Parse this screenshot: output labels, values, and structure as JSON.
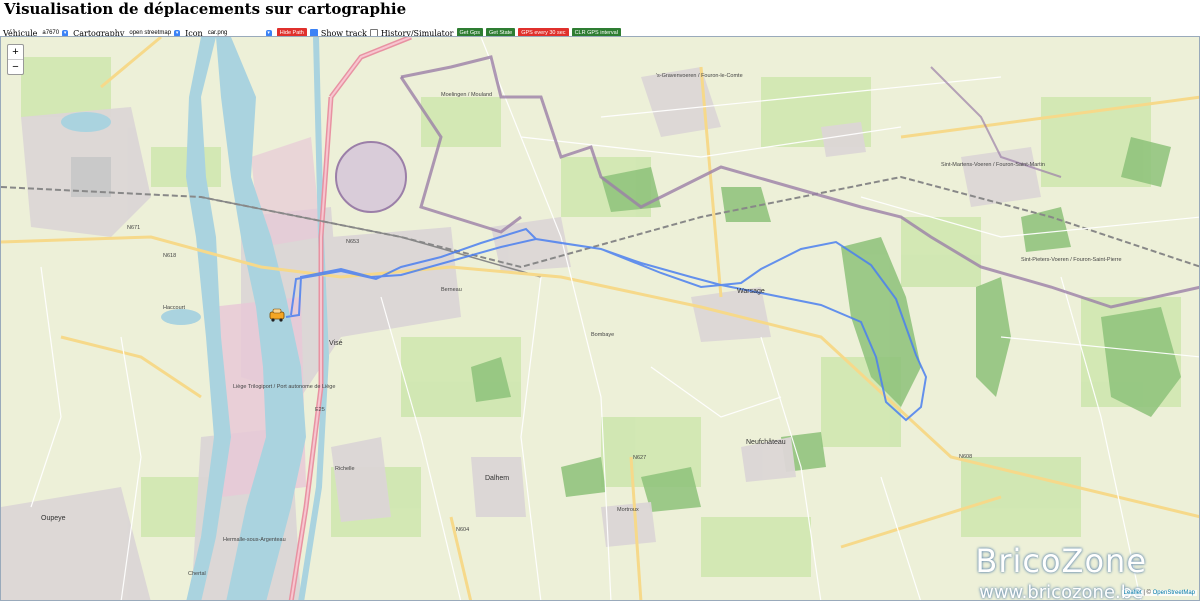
{
  "page": {
    "title": "Visualisation de déplacements sur cartographie"
  },
  "toolbar": {
    "vehicle_label": "Véhicule",
    "vehicle_value": "a7670",
    "cartography_label": "Cartography",
    "cartography_value": "open streetmap",
    "icon_label": "Icon",
    "icon_value": "car.png",
    "hide_path": "Hide Path",
    "show_track": "Show track",
    "history_simulator": "History/Simulator",
    "get_gps": "Get Gps",
    "get_state": "Get State",
    "gps_every": "GPS every 30 sec",
    "clr_gps": "CLR GPS interval"
  },
  "map": {
    "zoom_in": "+",
    "zoom_out": "−",
    "watermark_line1": "BricoZone",
    "watermark_line2": "www.bricozone.be",
    "attribution_leaflet": "Leaflet",
    "attribution_sep": " | © ",
    "attribution_osm": "OpenStreetMap",
    "track_color": "#4a7ff0",
    "places": {
      "vise": "Visé",
      "oupeye": "Oupeye",
      "hermalle": "Hermalle-sous-Argenteau",
      "cheratte": "Chertal",
      "warsage": "Warsage",
      "neufchateau": "Neufchâteau",
      "dalhem": "Dalhem",
      "mortroux": "Mortroux",
      "bombaye": "Bombaye",
      "haccourt": "Haccourt",
      "voeren": "Sint-Martens-Voeren / Fouron-Saint-Martin",
      "pieters": "Sint-Pieters-Voeren / Fouron-Saint-Pierre",
      "graven": "'s-Gravenvoeren / Fouron-le-Comte",
      "moelingen": "Moelingen / Mouland",
      "liege_port": "Liège Trilogiport / Port autonome de Liège",
      "richelle": "Richelle",
      "berneau": "Berneau",
      "n608": "N608",
      "n627": "N627",
      "n604": "N604",
      "n671": "N671",
      "n618": "N618",
      "n653": "N653",
      "e25": "E25"
    }
  }
}
